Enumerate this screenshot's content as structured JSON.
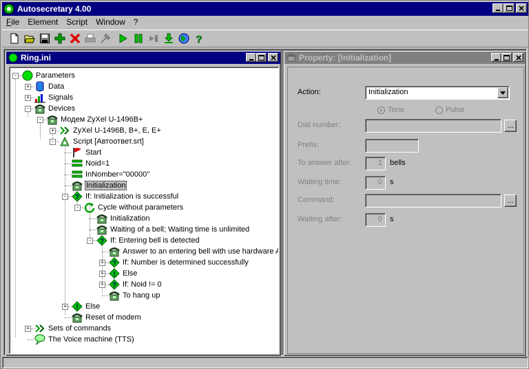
{
  "app": {
    "title": "Autosecretary 4.00",
    "accent": "#000080"
  },
  "menu": {
    "items": [
      {
        "label": "File",
        "underline": "F",
        "rest": "ile"
      },
      {
        "label": "Element",
        "underline": "",
        "rest": "Element"
      },
      {
        "label": "Script",
        "underline": "",
        "rest": "Script"
      },
      {
        "label": "Window",
        "underline": "",
        "rest": "Window"
      },
      {
        "label": "?",
        "underline": "",
        "rest": "?"
      }
    ]
  },
  "toolbar": {
    "icons": [
      "new-file-icon",
      "open-folder-icon",
      "save-icon",
      "add-icon",
      "delete-icon",
      "print-icon",
      "settings-icon",
      "play-icon",
      "pause-icon",
      "step-icon",
      "download-icon",
      "globe-icon",
      "help-icon"
    ]
  },
  "tree_window": {
    "title": "Ring.ini",
    "nodes": [
      {
        "label": "Parameters",
        "icon": "green-circle-icon"
      },
      {
        "label": "Data",
        "icon": "database-icon"
      },
      {
        "label": "Signals",
        "icon": "chart-icon"
      },
      {
        "label": "Devices",
        "icon": "phone-icon"
      },
      {
        "label": "Модем ZyXel U-1496B+",
        "icon": "phone-icon"
      },
      {
        "label": "ZyXel U-1496B, B+, E, E+",
        "icon": "arrows-icon"
      },
      {
        "label": "Script [Автоответ.srt]",
        "icon": "script-icon"
      },
      {
        "label": "Start",
        "icon": "red-flag-icon"
      },
      {
        "label": "Noid=1",
        "icon": "variable-icon"
      },
      {
        "label": "InNomber=\"00000\"",
        "icon": "variable-icon"
      },
      {
        "label": "Initialization",
        "icon": "phone-icon"
      },
      {
        "label": "If: Initialization is successful",
        "icon": "question-icon"
      },
      {
        "label": "Cycle without parameters",
        "icon": "cycle-icon"
      },
      {
        "label": "Initialization",
        "icon": "phone-icon"
      },
      {
        "label": "Waiting of a bell; Waiting time is unlimited",
        "icon": "phone-icon"
      },
      {
        "label": "If: Entering bell is detected",
        "icon": "question-icon"
      },
      {
        "label": "Answer to an entering bell with use hardware A",
        "icon": "phone-icon"
      },
      {
        "label": "If: Number is determined successfully",
        "icon": "question-icon"
      },
      {
        "label": "Else",
        "icon": "exclaim-icon"
      },
      {
        "label": "If: Noid != 0",
        "icon": "question-icon"
      },
      {
        "label": "To hang up",
        "icon": "phone-icon"
      },
      {
        "label": "Else",
        "icon": "exclaim-icon"
      },
      {
        "label": "Reset of modem",
        "icon": "phone-icon"
      },
      {
        "label": "Sets of commands",
        "icon": "arrows-icon"
      },
      {
        "label": "The Voice machine (TTS)",
        "icon": "speech-icon"
      }
    ]
  },
  "property_window": {
    "title": "Property: [Initialization]",
    "action_label": "Action:",
    "action_value": "Initialization",
    "tone_label": "Tone",
    "pulse_label": "Pulse",
    "dial_label": "Dial number:",
    "prefix_label": "Prefix:",
    "answer_label": "To answer after:",
    "answer_value": "1",
    "answer_unit": "bells",
    "waiting_label": "Waiting time:",
    "waiting_value": "0",
    "waiting_unit": "s",
    "command_label": "Command:",
    "waiting_after_label": "Waiting after:",
    "waiting_after_value": "0",
    "waiting_after_unit": "s",
    "browse_label": "..."
  }
}
